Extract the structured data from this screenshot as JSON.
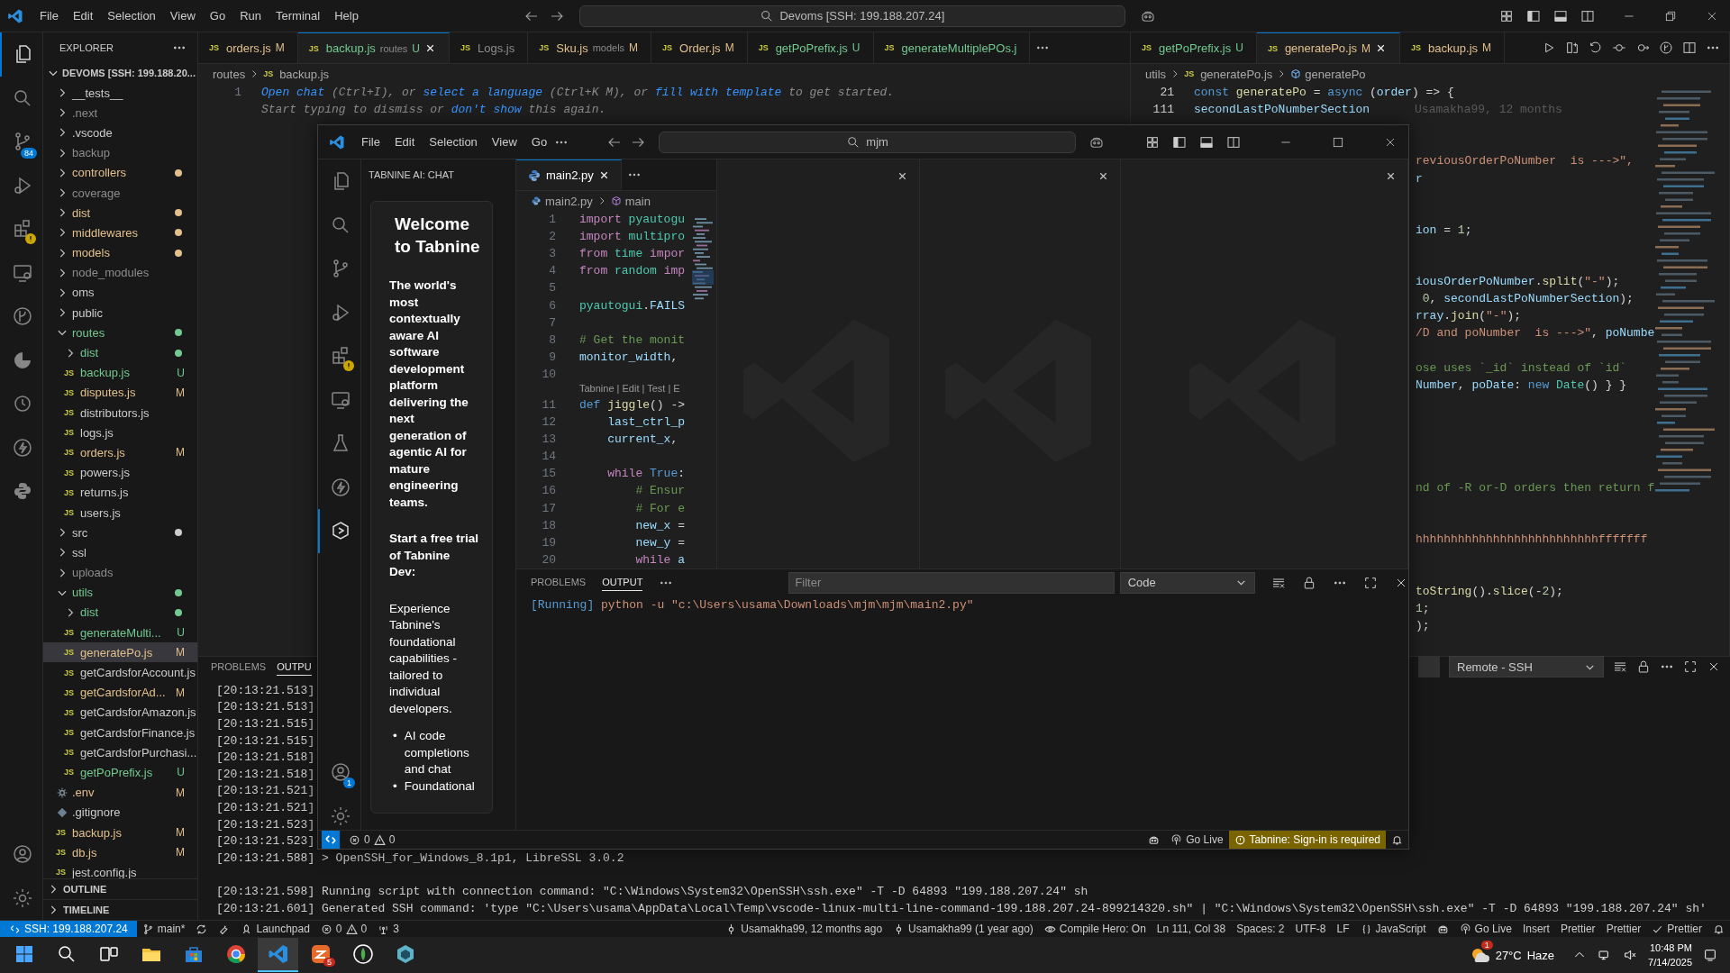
{
  "back": {
    "title_bar": {
      "menus": [
        "File",
        "Edit",
        "Selection",
        "View",
        "Go",
        "Run",
        "Terminal",
        "Help"
      ],
      "search": "Devoms [SSH: 199.188.207.24]"
    },
    "activity_bar": {
      "items": [
        {
          "kind": "files",
          "selected": true
        },
        {
          "kind": "search",
          "selected": false
        },
        {
          "kind": "branch",
          "selected": false,
          "badge": "84"
        },
        {
          "kind": "debug",
          "selected": false
        },
        {
          "kind": "extensions",
          "selected": false,
          "warning": true
        },
        {
          "kind": "monitor",
          "selected": false
        },
        {
          "kind": "graph",
          "selected": false
        },
        {
          "kind": "pie",
          "selected": false
        },
        {
          "kind": "timer",
          "selected": false
        },
        {
          "kind": "bolt",
          "selected": false
        },
        {
          "kind": "python",
          "selected": false
        }
      ],
      "bottom": [
        {
          "kind": "account"
        },
        {
          "kind": "gear"
        }
      ]
    },
    "sidebar": {
      "title": "EXPLORER",
      "root": "DEVOMS [SSH: 199.188.20...",
      "tree": [
        {
          "name": "__tests__",
          "kind": "folder",
          "expanded": false,
          "color": "#cccccc",
          "selected": false
        },
        {
          "name": ".next",
          "kind": "folder",
          "expanded": false,
          "color": "#8c8c8c",
          "selected": false
        },
        {
          "name": ".vscode",
          "kind": "folder",
          "expanded": false,
          "color": "#cccccc",
          "selected": false
        },
        {
          "name": "backup",
          "kind": "folder",
          "expanded": false,
          "color": "#8c8c8c",
          "selected": false
        },
        {
          "name": "controllers",
          "kind": "folder",
          "expanded": false,
          "color": "#e2c08d",
          "dot": true,
          "selected": false
        },
        {
          "name": "coverage",
          "kind": "folder",
          "expanded": false,
          "color": "#8c8c8c",
          "selected": false
        },
        {
          "name": "dist",
          "kind": "folder",
          "expanded": false,
          "color": "#e2c08d",
          "dot": true,
          "selected": false
        },
        {
          "name": "middlewares",
          "kind": "folder",
          "expanded": false,
          "color": "#e2c08d",
          "dot": true,
          "selected": false
        },
        {
          "name": "models",
          "kind": "folder",
          "expanded": false,
          "color": "#e2c08d",
          "dot": true,
          "selected": false
        },
        {
          "name": "node_modules",
          "kind": "folder",
          "expanded": false,
          "color": "#8c8c8c",
          "selected": false
        },
        {
          "name": "oms",
          "kind": "folder",
          "expanded": false,
          "color": "#cccccc",
          "selected": false
        },
        {
          "name": "public",
          "kind": "folder",
          "expanded": false,
          "color": "#cccccc",
          "selected": false
        },
        {
          "name": "routes",
          "kind": "folder",
          "expanded": true,
          "color": "#73c991",
          "dot": true,
          "selected": false,
          "children": [
            {
              "name": "dist",
              "kind": "folder",
              "expanded": false,
              "color": "#73c991",
              "dot": true,
              "selected": false
            },
            {
              "name": "backup.js",
              "kind": "file",
              "icon": "JS",
              "color": "#73c991",
              "badge": "U",
              "selected": false
            },
            {
              "name": "disputes.js",
              "kind": "file",
              "icon": "JS",
              "color": "#e2c08d",
              "badge": "M",
              "selected": false
            },
            {
              "name": "distributors.js",
              "kind": "file",
              "icon": "JS",
              "color": "#cccccc",
              "selected": false
            },
            {
              "name": "logs.js",
              "kind": "file",
              "icon": "JS",
              "color": "#cccccc",
              "selected": false
            },
            {
              "name": "orders.js",
              "kind": "file",
              "icon": "JS",
              "color": "#e2c08d",
              "badge": "M",
              "selected": false
            },
            {
              "name": "powers.js",
              "kind": "file",
              "icon": "JS",
              "color": "#cccccc",
              "selected": false
            },
            {
              "name": "returns.js",
              "kind": "file",
              "icon": "JS",
              "color": "#cccccc",
              "selected": false
            },
            {
              "name": "users.js",
              "kind": "file",
              "icon": "JS",
              "color": "#cccccc",
              "selected": false
            }
          ]
        },
        {
          "name": "src",
          "kind": "folder",
          "expanded": false,
          "color": "#cccccc",
          "dot": true,
          "selected": false
        },
        {
          "name": "ssl",
          "kind": "folder",
          "expanded": false,
          "color": "#cccccc",
          "selected": false
        },
        {
          "name": "uploads",
          "kind": "folder",
          "expanded": false,
          "color": "#8c8c8c",
          "selected": false
        },
        {
          "name": "utils",
          "kind": "folder",
          "expanded": true,
          "color": "#73c991",
          "dot": true,
          "selected": false,
          "children": [
            {
              "name": "dist",
              "kind": "folder",
              "expanded": false,
              "color": "#73c991",
              "dot": true,
              "selected": false
            },
            {
              "name": "generateMulti...",
              "kind": "file",
              "icon": "JS",
              "color": "#73c991",
              "badge": "U",
              "selected": false
            },
            {
              "name": "generatePo.js",
              "kind": "file",
              "icon": "JS",
              "color": "#e2c08d",
              "badge": "M",
              "selected": true
            },
            {
              "name": "getCardsforAccount.js",
              "kind": "file",
              "icon": "JS",
              "color": "#cccccc",
              "selected": false
            },
            {
              "name": "getCardsforAd...",
              "kind": "file",
              "icon": "JS",
              "color": "#e2c08d",
              "badge": "M",
              "selected": false
            },
            {
              "name": "getCardsforAmazon.js",
              "kind": "file",
              "icon": "JS",
              "color": "#cccccc",
              "selected": false
            },
            {
              "name": "getCardsforFinance.js",
              "kind": "file",
              "icon": "JS",
              "color": "#cccccc",
              "selected": false
            },
            {
              "name": "getCardsforPurchasi...",
              "kind": "file",
              "icon": "JS",
              "color": "#cccccc",
              "selected": false
            },
            {
              "name": "getPoPrefix.js",
              "kind": "file",
              "icon": "JS",
              "color": "#73c991",
              "badge": "U",
              "selected": false
            }
          ]
        },
        {
          "name": ".env",
          "kind": "env",
          "color": "#e2c08d",
          "badge": "M",
          "selected": false
        },
        {
          "name": ".gitignore",
          "kind": "gitignore",
          "color": "#cccccc",
          "selected": false
        },
        {
          "name": "backup.js",
          "kind": "file",
          "icon": "JS",
          "color": "#e2c08d",
          "badge": "M",
          "selected": false
        },
        {
          "name": "db.js",
          "kind": "file",
          "icon": "JS",
          "color": "#e2c08d",
          "badge": "M",
          "selected": false
        },
        {
          "name": "jest.config.js",
          "kind": "file",
          "icon": "JS",
          "color": "#cccccc",
          "selected": false
        }
      ],
      "sections": [
        "OUTLINE",
        "TIMELINE"
      ]
    },
    "editor": {
      "groups": [
        {
          "tabs": [
            {
              "label": "orders.js",
              "icon": "JS",
              "color": "#e2c08d",
              "badge": "M",
              "selected": false
            },
            {
              "label": "backup.js",
              "icon": "JS",
              "detail": "routes",
              "color": "#73c991",
              "badge": "U",
              "selected": true
            },
            {
              "label": "Logs.js",
              "icon": "JS",
              "color": "#8c8c8c",
              "selected": false
            },
            {
              "label": "Sku.js",
              "icon": "JS",
              "detail": "models",
              "color": "#e2c08d",
              "badge": "M",
              "selected": false
            },
            {
              "label": "Order.js",
              "icon": "JS",
              "color": "#e2c08d",
              "badge": "M",
              "selected": false
            },
            {
              "label": "getPoPrefix.js",
              "icon": "JS",
              "color": "#73c991",
              "badge": "U",
              "selected": false
            },
            {
              "label": "generateMultiplePOs.j",
              "icon": "JS",
              "color": "#73c991",
              "selected": false
            }
          ],
          "breadcrumbs": [
            {
              "text": "routes"
            },
            {
              "text": "backup.js",
              "icon": "JS"
            }
          ],
          "lines": [
            {
              "n": "1",
              "segs": [
                {
                  "text": "Open chat",
                  "kind": "link"
                },
                {
                  "text": " (Ctrl+I), or ",
                  "kind": "hint"
                },
                {
                  "text": "select a language",
                  "kind": "link"
                },
                {
                  "text": " (Ctrl+K M), or ",
                  "kind": "hint"
                },
                {
                  "text": "fill with template",
                  "kind": "link"
                },
                {
                  "text": " to get started.",
                  "kind": "hint"
                }
              ]
            },
            {
              "segs": [
                {
                  "text": "Start typing to dismiss or ",
                  "kind": "hint"
                },
                {
                  "text": "don't show",
                  "kind": "link"
                },
                {
                  "text": " this again.",
                  "kind": "hint"
                }
              ]
            }
          ]
        },
        {
          "tabs": [
            {
              "label": "getPoPrefix.js",
              "icon": "JS",
              "color": "#73c991",
              "badge": "U",
              "selected": false
            },
            {
              "label": "generatePo.js",
              "icon": "JS",
              "color": "#e2c08d",
              "badge": "M",
              "selected": true
            },
            {
              "label": "backup.js",
              "icon": "JS",
              "color": "#e2c08d",
              "badge": "M",
              "selected": false
            }
          ],
          "actions": [
            {
              "kind": "play"
            },
            {
              "kind": "compare"
            },
            {
              "kind": "revert"
            },
            {
              "kind": "dotcircle"
            },
            {
              "kind": "circlearrow"
            },
            {
              "kind": "branchcircle"
            },
            {
              "kind": "split"
            },
            {
              "kind": "more"
            }
          ],
          "breadcrumbs": [
            {
              "text": "utils"
            },
            {
              "text": "generatePo.js",
              "icon": "JS"
            },
            {
              "text": "generatePo",
              "kind": "symbol"
            }
          ],
          "lines": [
            {
              "n": "21",
              "segs": [
                {
                  "text": "const ",
                  "kind": "kw2"
                },
                {
                  "text": "generatePo",
                  "kind": "fn"
                },
                {
                  "text": " = ",
                  "kind": "plain"
                },
                {
                  "text": "async",
                  "kind": "kw2"
                },
                {
                  "text": " (",
                  "kind": "plain"
                },
                {
                  "text": "order",
                  "kind": "var"
                },
                {
                  "text": ") => {",
                  "kind": "plain"
                }
              ]
            },
            {
              "n": "111",
              "segs": [
                {
                  "text": "secondLastPoNumberSection",
                  "kind": "var"
                }
              ],
              "blame": "Usamakha99, 12 months"
            }
          ],
          "fragments": [
            {
              "kind": "blank"
            },
            {
              "kind": "blank"
            },
            {
              "segs": [
                {
                  "text": "reviousOrderPoNumber  is --->\",",
                  "kind": "str"
                }
              ]
            },
            {
              "segs": [
                {
                  "text": "r",
                  "kind": "var"
                }
              ]
            },
            {
              "kind": "blank"
            },
            {
              "kind": "blank"
            },
            {
              "segs": [
                {
                  "text": "ion",
                  "kind": "var"
                },
                {
                  "text": " = ",
                  "kind": "plain"
                },
                {
                  "text": "1",
                  "kind": "num"
                },
                {
                  "text": ";",
                  "kind": "plain"
                }
              ]
            },
            {
              "kind": "blank"
            },
            {
              "kind": "blank"
            },
            {
              "segs": [
                {
                  "text": "iousOrderPoNumber",
                  "kind": "var"
                },
                {
                  "text": ".",
                  "kind": "plain"
                },
                {
                  "text": "split",
                  "kind": "fn"
                },
                {
                  "text": "(",
                  "kind": "plain"
                },
                {
                  "text": "\"-\"",
                  "kind": "str"
                },
                {
                  "text": ");",
                  "kind": "plain"
                }
              ]
            },
            {
              "segs": [
                {
                  "text": " 0",
                  "kind": "num"
                },
                {
                  "text": ", ",
                  "kind": "plain"
                },
                {
                  "text": "secondLastPoNumberSection",
                  "kind": "var"
                },
                {
                  "text": ");",
                  "kind": "plain"
                }
              ]
            },
            {
              "segs": [
                {
                  "text": "rray",
                  "kind": "var"
                },
                {
                  "text": ".",
                  "kind": "plain"
                },
                {
                  "text": "join",
                  "kind": "fn"
                },
                {
                  "text": "(",
                  "kind": "plain"
                },
                {
                  "text": "\"-\"",
                  "kind": "str"
                },
                {
                  "text": ");",
                  "kind": "plain"
                }
              ]
            },
            {
              "segs": [
                {
                  "text": "/D and poNumber  is --->\"",
                  "kind": "str"
                },
                {
                  "text": ", ",
                  "kind": "plain"
                },
                {
                  "text": "poNumbe",
                  "kind": "var"
                }
              ]
            },
            {
              "kind": "blank"
            },
            {
              "segs": [
                {
                  "text": "ose uses `_id` instead of `id`",
                  "kind": "cm"
                }
              ]
            },
            {
              "segs": [
                {
                  "text": "Number",
                  "kind": "var"
                },
                {
                  "text": ", ",
                  "kind": "plain"
                },
                {
                  "text": "poDate",
                  "kind": "var"
                },
                {
                  "text": ": ",
                  "kind": "plain"
                },
                {
                  "text": "new ",
                  "kind": "kw2"
                },
                {
                  "text": "Date",
                  "kind": "cls"
                },
                {
                  "text": "() } }",
                  "kind": "plain"
                }
              ]
            },
            {
              "kind": "blank"
            },
            {
              "kind": "blank"
            },
            {
              "kind": "blank"
            },
            {
              "kind": "blank"
            },
            {
              "kind": "blank"
            },
            {
              "segs": [
                {
                  "text": "nd of -R or-D orders then return f",
                  "kind": "cm"
                }
              ]
            },
            {
              "kind": "blank"
            },
            {
              "kind": "blank"
            },
            {
              "segs": [
                {
                  "text": "hhhhhhhhhhhhhhhhhhhhhhhhhhfffffff",
                  "kind": "str"
                }
              ]
            },
            {
              "kind": "blank"
            },
            {
              "kind": "blank"
            },
            {
              "segs": [
                {
                  "text": "toString",
                  "kind": "fn"
                },
                {
                  "text": "().",
                  "kind": "plain"
                },
                {
                  "text": "slice",
                  "kind": "fn"
                },
                {
                  "text": "(-",
                  "kind": "plain"
                },
                {
                  "text": "2",
                  "kind": "num"
                },
                {
                  "text": ");",
                  "kind": "plain"
                }
              ]
            },
            {
              "segs": [
                {
                  "text": "1",
                  "kind": "num"
                },
                {
                  "text": ";",
                  "kind": "plain"
                }
              ]
            },
            {
              "segs": [
                {
                  "text": ");",
                  "kind": "plain"
                }
              ]
            }
          ]
        }
      ]
    },
    "panel": {
      "tabs": [
        {
          "label": "PROBLEMS",
          "selected": false
        },
        {
          "label": "OUTPU",
          "selected": true
        }
      ],
      "dropdown": "Remote - SSH",
      "log": [
        {
          "text": "[20:13:21.513]"
        },
        {
          "text": "[20:13:21.513]"
        },
        {
          "text": "[20:13:21.515]"
        },
        {
          "text": "[20:13:21.515]"
        },
        {
          "text": "[20:13:21.518]"
        },
        {
          "text": "[20:13:21.518]"
        },
        {
          "text": "[20:13:21.521]"
        },
        {
          "text": "[20:13:21.521]"
        },
        {
          "text": "[20:13:21.523]"
        },
        {
          "text": "[20:13:21.523]"
        },
        {
          "text": "[20:13:21.588] > OpenSSH_for_Windows_8.1p1, LibreSSL 3.0.2"
        },
        {
          "kind": "blank"
        },
        {
          "text": "[20:13:21.598] Running script with connection command: \"C:\\Windows\\System32\\OpenSSH\\ssh.exe\" -T -D 64893 \"199.188.207.24\" sh"
        },
        {
          "text": "[20:13:21.601] Generated SSH command: 'type \"C:\\Users\\usama\\AppData\\Local\\Temp\\vscode-linux-multi-line-command-199.188.207.24-899214320.sh\" | \"C:\\Windows\\System32\\OpenSSH\\ssh.exe\" -T -D 64893 \"199.188.207.24\" sh'"
        }
      ]
    },
    "status_bar": {
      "left": [
        {
          "kind": "remote",
          "text": "SSH: 199.188.207.24"
        },
        {
          "kind": "branch",
          "text": "main*"
        },
        {
          "kind": "sync"
        },
        {
          "kind": "tool"
        },
        {
          "kind": "launch",
          "text": "Launchpad"
        },
        {
          "kind": "problems",
          "errors": "0",
          "warnings": "0"
        },
        {
          "kind": "ports",
          "text": "3"
        }
      ],
      "right": [
        {
          "kind": "blame",
          "text": "Usamakha99, 12 months ago"
        },
        {
          "kind": "blame",
          "text": "Usamakha99 (1 year ago)"
        },
        {
          "kind": "eye",
          "text": "Compile Hero: On"
        },
        {
          "kind": "text",
          "text": "Ln 111, Col 38"
        },
        {
          "kind": "text",
          "text": "Spaces: 2"
        },
        {
          "kind": "text",
          "text": "UTF-8"
        },
        {
          "kind": "text",
          "text": "LF"
        },
        {
          "kind": "braces",
          "text": "JavaScript"
        },
        {
          "kind": "copilot"
        },
        {
          "kind": "live",
          "text": "Go Live"
        },
        {
          "kind": "text",
          "text": "Insert"
        },
        {
          "kind": "text",
          "text": "Prettier"
        },
        {
          "kind": "text",
          "text": "Prettier"
        },
        {
          "kind": "check",
          "text": "Prettier"
        },
        {
          "kind": "bell"
        }
      ]
    }
  },
  "front": {
    "title_bar": {
      "menus": [
        "File",
        "Edit",
        "Selection",
        "View",
        "Go"
      ],
      "search": "mjm"
    },
    "activity_bar": {
      "items": [
        {
          "kind": "files",
          "selected": false
        },
        {
          "kind": "search",
          "selected": false
        },
        {
          "kind": "branch",
          "selected": false
        },
        {
          "kind": "debug",
          "selected": false
        },
        {
          "kind": "extensions",
          "selected": false,
          "warning": true
        },
        {
          "kind": "monitor",
          "selected": false
        },
        {
          "kind": "flask",
          "selected": false
        },
        {
          "kind": "bolt",
          "selected": false
        },
        {
          "kind": "tabnine",
          "selected": true
        }
      ],
      "bottom": [
        {
          "kind": "account",
          "badge": "1"
        },
        {
          "kind": "gear"
        }
      ]
    },
    "sidebar": {
      "title": "TABNINE AI: CHAT",
      "heading": "Welcome to Tabnine",
      "intro": "The world's most contextually aware AI software development platform delivering the next generation of agentic AI for mature engineering teams.",
      "cta": "Start a free trial of Tabnine Dev:",
      "body": "Experience Tabnine's foundational capabilities - tailored to individual developers.",
      "bullets": [
        {
          "marker": "•",
          "text": "AI code completions and chat"
        },
        {
          "marker": "•",
          "text": "Foundational"
        }
      ]
    },
    "editor": {
      "tab": {
        "label": "main2.py",
        "selected": true
      },
      "breadcrumbs": [
        "main2.py",
        "main"
      ],
      "lines": [
        {
          "n": "1",
          "segs": [
            {
              "text": "import",
              "kind": "kw"
            },
            {
              "text": " pyautogu",
              "kind": "cls"
            }
          ]
        },
        {
          "n": "2",
          "segs": [
            {
              "text": "import",
              "kind": "kw"
            },
            {
              "text": " multipro",
              "kind": "cls"
            }
          ]
        },
        {
          "n": "3",
          "segs": [
            {
              "text": "from",
              "kind": "kw"
            },
            {
              "text": " time ",
              "kind": "cls"
            },
            {
              "text": "impor",
              "kind": "kw"
            }
          ]
        },
        {
          "n": "4",
          "segs": [
            {
              "text": "from",
              "kind": "kw"
            },
            {
              "text": " random ",
              "kind": "cls"
            },
            {
              "text": "imp",
              "kind": "kw"
            }
          ]
        },
        {
          "n": "5"
        },
        {
          "n": "6",
          "segs": [
            {
              "text": "pyautogui",
              "kind": "cls"
            },
            {
              "text": ".",
              "kind": "plain"
            },
            {
              "text": "FAILS",
              "kind": "var"
            }
          ]
        },
        {
          "n": "7"
        },
        {
          "n": "8",
          "segs": [
            {
              "text": "# Get the monit",
              "kind": "cm"
            }
          ]
        },
        {
          "n": "9",
          "segs": [
            {
              "text": "monitor_width",
              "kind": "var"
            },
            {
              "text": ",",
              "kind": "plain"
            }
          ]
        },
        {
          "n": "10"
        },
        {
          "kind": "codelens",
          "text": "Tabnine | Edit | Test | E"
        },
        {
          "n": "11",
          "segs": [
            {
              "text": "def ",
              "kind": "kw2"
            },
            {
              "text": "jiggle",
              "kind": "fn"
            },
            {
              "text": "() ->",
              "kind": "plain"
            }
          ]
        },
        {
          "n": "12",
          "segs": [
            {
              "text": "    last_ctrl_p",
              "kind": "var"
            }
          ]
        },
        {
          "n": "13",
          "segs": [
            {
              "text": "    current_x",
              "kind": "var"
            },
            {
              "text": ",",
              "kind": "plain"
            }
          ]
        },
        {
          "n": "14"
        },
        {
          "n": "15",
          "segs": [
            {
              "text": "    while ",
              "kind": "kw"
            },
            {
              "text": "True",
              "kind": "kw2"
            },
            {
              "text": ":",
              "kind": "plain"
            }
          ]
        },
        {
          "n": "16",
          "segs": [
            {
              "text": "        # Ensur",
              "kind": "cm"
            }
          ]
        },
        {
          "n": "17",
          "segs": [
            {
              "text": "        # For e",
              "kind": "cm"
            }
          ]
        },
        {
          "n": "18",
          "segs": [
            {
              "text": "        new_x",
              "kind": "var"
            },
            {
              "text": " =",
              "kind": "plain"
            }
          ]
        },
        {
          "n": "19",
          "segs": [
            {
              "text": "        new_y",
              "kind": "var"
            },
            {
              "text": " =",
              "kind": "plain"
            }
          ]
        },
        {
          "n": "20",
          "segs": [
            {
              "text": "        while",
              "kind": "kw"
            },
            {
              "text": " a",
              "kind": "var"
            }
          ]
        }
      ]
    },
    "empty_groups": [
      {
        "kind": "empty"
      },
      {
        "kind": "empty"
      },
      {
        "kind": "empty"
      }
    ],
    "panel": {
      "tabs": [
        {
          "label": "PROBLEMS",
          "selected": false
        },
        {
          "label": "OUTPUT",
          "selected": true
        }
      ],
      "filter": {
        "placeholder": "Filter"
      },
      "dropdown": "Code",
      "output": [
        {
          "segs": [
            {
              "text": "[Running]",
              "kind": "info"
            },
            {
              "text": " python -u \"c:\\Users\\usama\\Downloads\\mjm\\mjm\\main2.py\"",
              "kind": "str"
            }
          ]
        }
      ]
    },
    "status_bar": {
      "errors": "0",
      "warnings": "0",
      "right": [
        {
          "kind": "copilot"
        },
        {
          "kind": "live",
          "text": "Go Live"
        },
        {
          "kind": "warning",
          "text": "Tabnine: Sign-in is required"
        },
        {
          "kind": "bell"
        }
      ]
    }
  },
  "taskbar": {
    "apps": [
      {
        "kind": "windows",
        "selected": false
      },
      {
        "kind": "search",
        "selected": false
      },
      {
        "kind": "taskview",
        "selected": false
      },
      {
        "kind": "folder",
        "selected": false
      },
      {
        "kind": "store",
        "selected": false
      },
      {
        "kind": "chrome",
        "selected": false
      },
      {
        "kind": "vscode",
        "selected": true
      },
      {
        "kind": "zoom",
        "selected": false,
        "badge": "5"
      },
      {
        "kind": "green",
        "selected": false
      },
      {
        "kind": "diamond",
        "selected": false
      }
    ],
    "weather": {
      "temp": "27°C",
      "condition": "Haze",
      "badge": "1"
    },
    "time": "10:48 PM",
    "date": "7/14/2025"
  }
}
